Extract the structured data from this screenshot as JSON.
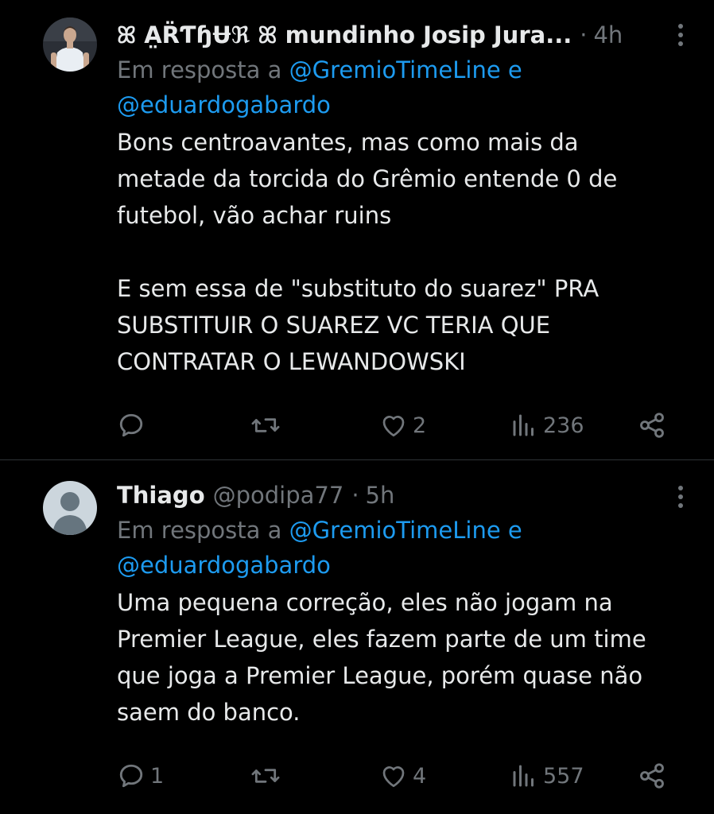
{
  "tweets": [
    {
      "display_name": "ꕤ A̤R̈ƬɧɄℜ ꕤ mundinho Josip Jura...",
      "handle": "",
      "time": "4h",
      "reply_prefix": "Em resposta a ",
      "reply_mention_1": "@GremioTimeLine",
      "reply_and": " e",
      "reply_mention_2": "@eduardogabardo",
      "text_lines": [
        "Bons centroavantes, mas como mais da",
        "metade da torcida do Grêmio entende 0 de",
        "futebol, vão achar ruins",
        "",
        "E sem essa de \"substituto do suarez\" PRA",
        "SUBSTITUIR O SUAREZ VC TERIA QUE",
        "CONTRATAR O LEWANDOWSKI"
      ],
      "replies": "",
      "retweets": "",
      "likes": "2",
      "views": "236",
      "avatar": "profile-photo"
    },
    {
      "display_name": "Thiago",
      "handle": "@podipa77",
      "time": "5h",
      "reply_prefix": "Em resposta a ",
      "reply_mention_1": "@GremioTimeLine",
      "reply_and": " e",
      "reply_mention_2": "@eduardogabardo",
      "text_lines": [
        "Uma pequena correção, eles não jogam na",
        "Premier League, eles fazem parte de um time",
        "que joga a Premier League, porém quase não",
        "saem do banco."
      ],
      "replies": "1",
      "retweets": "",
      "likes": "4",
      "views": "557",
      "avatar": "default-avatar"
    }
  ],
  "icons": {
    "reply": "reply-icon",
    "retweet": "retweet-icon",
    "like": "heart-icon",
    "views": "views-icon",
    "share": "share-icon",
    "more": "more-icon"
  },
  "colors": {
    "background": "#000000",
    "text": "#e7e9ea",
    "secondary": "#71767b",
    "mention": "#1d9bf0",
    "divider": "#2f3336"
  }
}
